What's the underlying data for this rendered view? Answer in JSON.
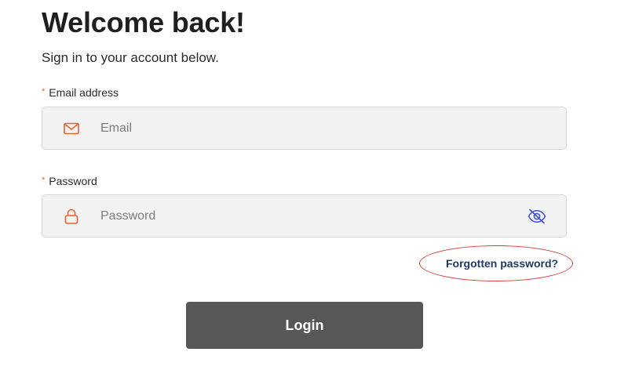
{
  "header": {
    "title": "Welcome back!",
    "subtitle": "Sign in to your account below."
  },
  "form": {
    "email": {
      "label": "Email address",
      "required_mark": "*",
      "placeholder": "Email",
      "value": "",
      "icon": "envelope-icon"
    },
    "password": {
      "label": "Password",
      "required_mark": "*",
      "placeholder": "Password",
      "value": "",
      "icon": "lock-icon",
      "toggle_icon": "eye-slash-icon"
    },
    "forgot_password": "Forgotten password?",
    "login_label": "Login"
  },
  "colors": {
    "accent_orange": "#e8632b",
    "link_navy": "#1e3a66",
    "toggle_blue": "#3a4fd8",
    "button_bg": "#575757",
    "annotation_red": "#d63a3a"
  }
}
